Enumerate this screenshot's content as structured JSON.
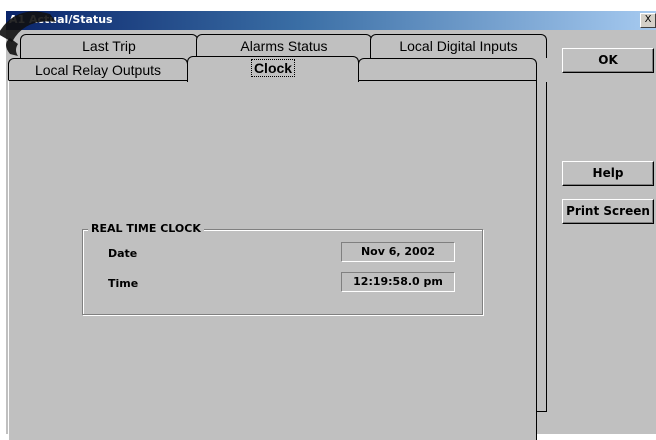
{
  "window": {
    "title": "A1 Actual/Status",
    "close_label": "X"
  },
  "tabs": {
    "row_back": [
      "Last Trip",
      "Alarms Status",
      "Local Digital Inputs"
    ],
    "row_front": [
      "Local Relay Outputs",
      "Clock"
    ],
    "active": "Clock"
  },
  "buttons": {
    "ok": "OK",
    "help": "Help",
    "print": "Print Screen"
  },
  "clock_group": {
    "title": "REAL TIME CLOCK",
    "date_label": "Date",
    "date_value": "Nov 6, 2002",
    "time_label": "Time",
    "time_value": "12:19:58.0 pm"
  }
}
